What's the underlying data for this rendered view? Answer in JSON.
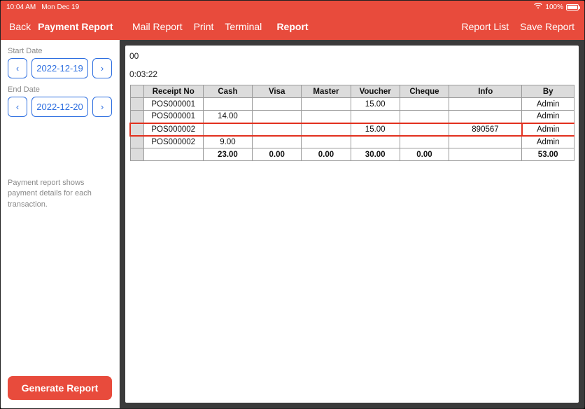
{
  "status": {
    "time": "10:04 AM",
    "date": "Mon Dec 19",
    "battery": "100%"
  },
  "nav": {
    "back": "Back",
    "title": "Payment Report",
    "mail": "Mail Report",
    "print": "Print",
    "terminal": "Terminal",
    "center": "Report",
    "list": "Report List",
    "save": "Save Report"
  },
  "sidebar": {
    "start_label": "Start Date",
    "start_value": "2022-12-19",
    "end_label": "End Date",
    "end_value": "2022-12-20",
    "desc": "Payment report shows payment details for each transaction.",
    "generate": "Generate Report"
  },
  "report": {
    "meta_top": "00",
    "meta_time": "0:03:22",
    "headers": [
      "Receipt No",
      "Cash",
      "Visa",
      "Master",
      "Voucher",
      "Cheque",
      "Info",
      "By"
    ],
    "rows": [
      {
        "receipt": "POS000001",
        "cash": "",
        "visa": "",
        "master": "",
        "voucher": "15.00",
        "cheque": "",
        "info": "",
        "by": "Admin",
        "hl": false
      },
      {
        "receipt": "POS000001",
        "cash": "14.00",
        "visa": "",
        "master": "",
        "voucher": "",
        "cheque": "",
        "info": "",
        "by": "Admin",
        "hl": false
      },
      {
        "receipt": "POS000002",
        "cash": "",
        "visa": "",
        "master": "",
        "voucher": "15.00",
        "cheque": "",
        "info": "890567",
        "by": "Admin",
        "hl": true
      },
      {
        "receipt": "POS000002",
        "cash": "9.00",
        "visa": "",
        "master": "",
        "voucher": "",
        "cheque": "",
        "info": "",
        "by": "Admin",
        "hl": false
      }
    ],
    "totals": {
      "cash": "23.00",
      "visa": "0.00",
      "master": "0.00",
      "voucher": "30.00",
      "cheque": "0.00",
      "info": "",
      "by": "53.00"
    }
  }
}
